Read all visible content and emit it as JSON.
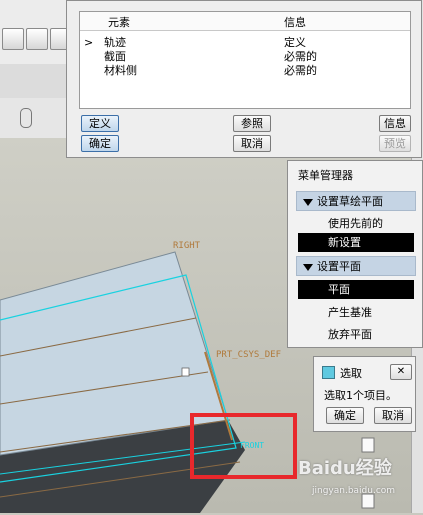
{
  "feature_dialog": {
    "columns": [
      "元素",
      "信息"
    ],
    "rows": [
      {
        "marker": ">",
        "element": "轨迹",
        "info": "定义"
      },
      {
        "marker": "",
        "element": "截面",
        "info": "必需的"
      },
      {
        "marker": "",
        "element": "材料侧",
        "info": "必需的"
      }
    ],
    "buttons": {
      "define": "定义",
      "reference": "参照",
      "info": "信息",
      "ok": "确定",
      "cancel": "取消",
      "preview": "预览"
    }
  },
  "menu_manager": {
    "title": "菜单管理器",
    "sketch_plane": {
      "header": "设置草绘平面",
      "items": [
        "使用先前的",
        "新设置"
      ],
      "selected": "新设置"
    },
    "set_plane": {
      "header": "设置平面",
      "items": [
        "平面",
        "产生基准",
        "放弃平面"
      ],
      "selected": "平面"
    }
  },
  "select_dialog": {
    "title": "选取",
    "message": "选取1个项目。",
    "ok": "确定",
    "cancel": "取消"
  },
  "model_labels": {
    "right": "RIGHT",
    "csys": "PRT_CSYS_DEF",
    "front": "FRONT"
  },
  "watermark": {
    "brand": "Baidu经验",
    "url": "jingyan.baidu.com"
  },
  "colors": {
    "highlight_box": "#e8282c",
    "datum_cyan": "#19d2e0",
    "datum_label": "#b07a3c",
    "part_face": "#c6d6e2",
    "part_dark": "#3b3f43",
    "menu_section": "#c5d4e4",
    "selected_item": "#000000"
  }
}
